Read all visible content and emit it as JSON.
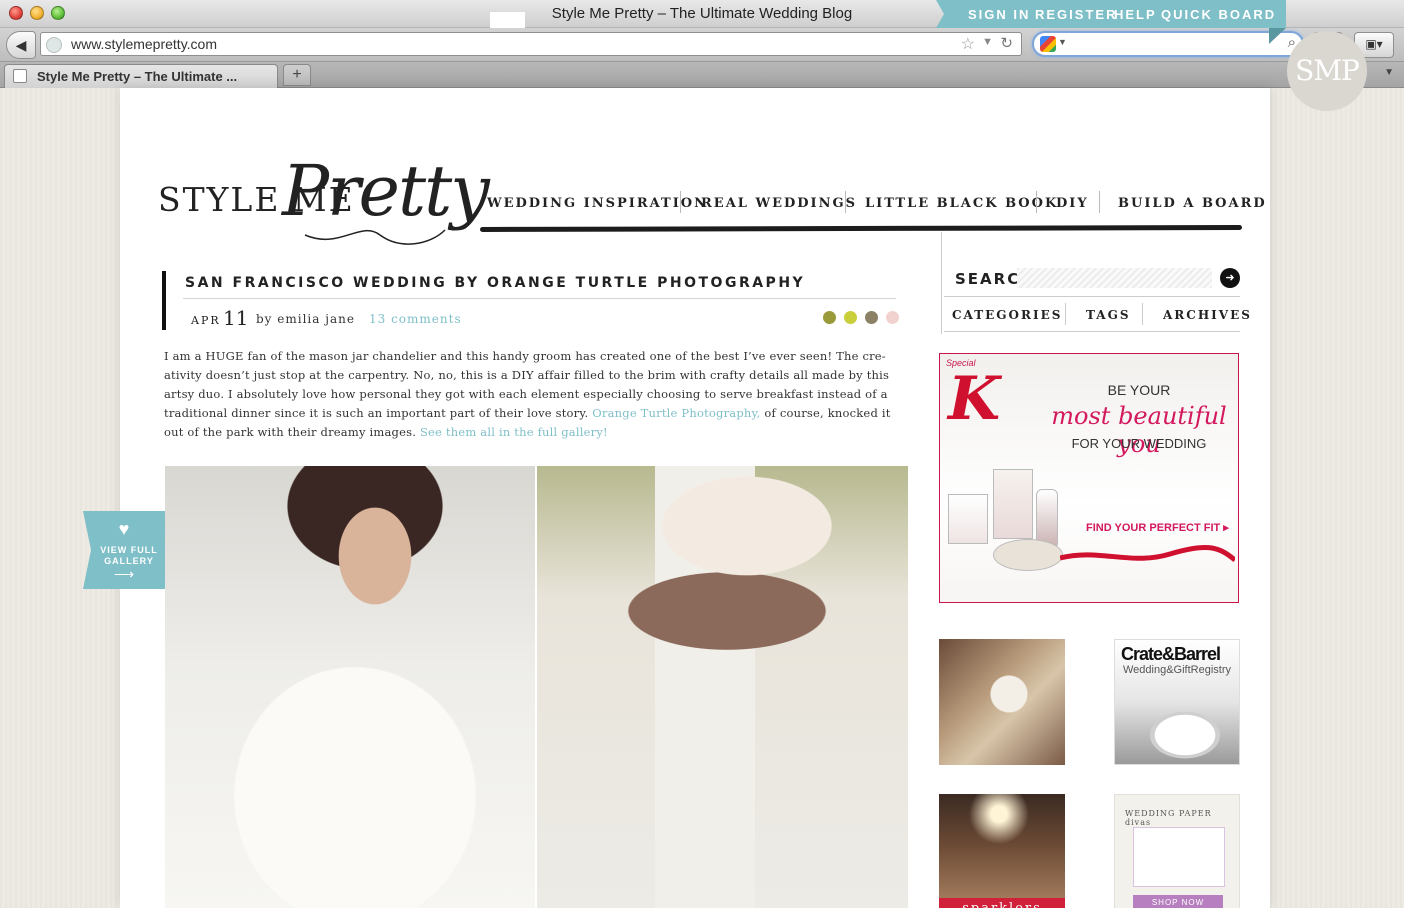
{
  "browser": {
    "window_title": "Style Me Pretty – The Ultimate Wedding Blog",
    "url": "www.stylemepretty.com",
    "search_value": "",
    "tab_label": "Style Me Pretty – The Ultimate ..."
  },
  "topnav": [
    "SIGN IN",
    "REGISTER",
    "HELP",
    "QUICK BOARD"
  ],
  "badge": "SMP",
  "logo": {
    "text": "STYLE ME",
    "script": "Pretty"
  },
  "mainnav": [
    "WEDDING INSPIRATION",
    "REAL WEDDINGS",
    "LITTLE BLACK BOOK",
    "DIY",
    "BUILD A BOARD"
  ],
  "post": {
    "title": "SAN FRANCISCO WEDDING BY ORANGE TURTLE PHOTOGRAPHY",
    "month": "APR",
    "day": "11",
    "byline": "by emilia jane",
    "comments": "13 comments",
    "swatches": [
      "#9a9a3a",
      "#c9cf3a",
      "#8c8066",
      "#f2d2cf"
    ],
    "body_part1": "I am a HUGE fan of the mason jar chandelier and this handy groom has created one of the best I’ve ever seen!  The cre-ativity doesn’t just stop at the carpentry.  No, no, this is a DIY affair filled to the brim with crafty details all made by this artsy duo.  I absolutely love how personal they got with each element especially choosing to serve breakfast instead of a traditional dinner since it is such an important part of their love story.  ",
    "body_link1": "Orange Turtle Photography,",
    "body_part2": " of course, knocked it out of the park with their dreamy images.  ",
    "body_link2": "See them all in the full gallery!"
  },
  "gallery_tab": {
    "label_line1": "VIEW FULL",
    "label_line2": "GALLERY",
    "heart": "♥",
    "arrow": "⟶"
  },
  "sidebar": {
    "search_label": "SEARCH",
    "search_placeholder": "",
    "links": [
      "CATEGORIES",
      "TAGS",
      "ARCHIVES"
    ]
  },
  "ads": {
    "special_k": {
      "brand": "Special",
      "letter": "K",
      "line1": "BE YOUR",
      "line2": "most beautiful you",
      "line3": "FOR YOUR WEDDING",
      "cta": "FIND YOUR PERFECT FIT ▸"
    },
    "crate_barrel": {
      "name": "Crate&Barrel",
      "sub": "Wedding&GiftRegistry"
    },
    "sparklers": {
      "label": "sparklers"
    },
    "wedding_paper_divas": {
      "brand": "WEDDING PAPER divas",
      "shop": "SHOP NOW"
    }
  },
  "colors": {
    "accent_teal": "#7fbfc8",
    "ad_pink": "#d3185d",
    "nav_black": "#1c1c1c"
  }
}
